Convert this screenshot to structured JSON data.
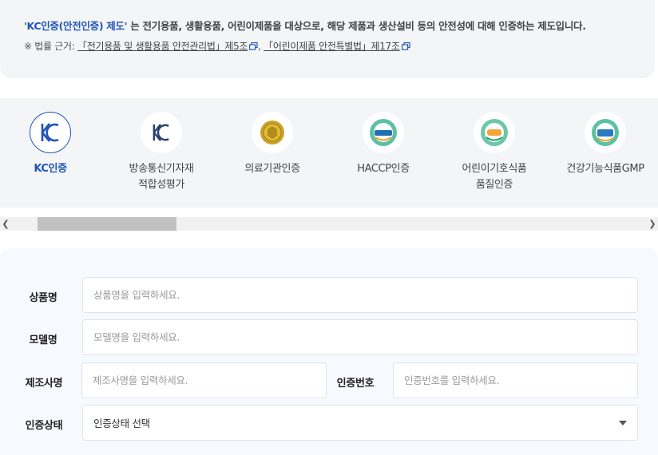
{
  "info": {
    "highlight": "'KC인증(안전인증) 제도'",
    "description": " 는 전기용품, 생활용품, 어린이제품을 대상으로, 해당 제품과 생산설비 등의 안전성에 대해 인증하는 제도입니다.",
    "basis_prefix": "※ 법률 근거: ",
    "law1": "「전기용품 및 생활용품 안전관리법」제5조",
    "separator": ", ",
    "law2": "「어린이제품 안전특별법」제17조"
  },
  "certs": [
    {
      "label": "KC인증",
      "icon": "kc-mark-icon",
      "active": true
    },
    {
      "label": "방송통신기자재\n적합성평가",
      "icon": "kc-mark-icon",
      "active": false
    },
    {
      "label": "의료기관인증",
      "icon": "gold-seal-icon",
      "active": false
    },
    {
      "label": "HACCP인증",
      "icon": "haccp-icon",
      "active": false
    },
    {
      "label": "어린이기호식품\n품질인증",
      "icon": "kids-food-quality-icon",
      "active": false
    },
    {
      "label": "건강기능식품GMP",
      "icon": "gmp-icon",
      "active": false
    }
  ],
  "form": {
    "product_name": {
      "label": "상품명",
      "placeholder": "상품명을 입력하세요."
    },
    "model_name": {
      "label": "모델명",
      "placeholder": "모델명을 입력하세요."
    },
    "manufacturer": {
      "label": "제조사명",
      "placeholder": "제조사명을 입력하세요."
    },
    "cert_number": {
      "label": "인증번호",
      "placeholder": "인증번호를 입력하세요."
    },
    "cert_status": {
      "label": "인증상태",
      "selected": "인증상태 선택"
    }
  },
  "colors": {
    "accent": "#2054b8",
    "panel": "#f4f5f7",
    "form_bg": "#f6f9fd"
  }
}
